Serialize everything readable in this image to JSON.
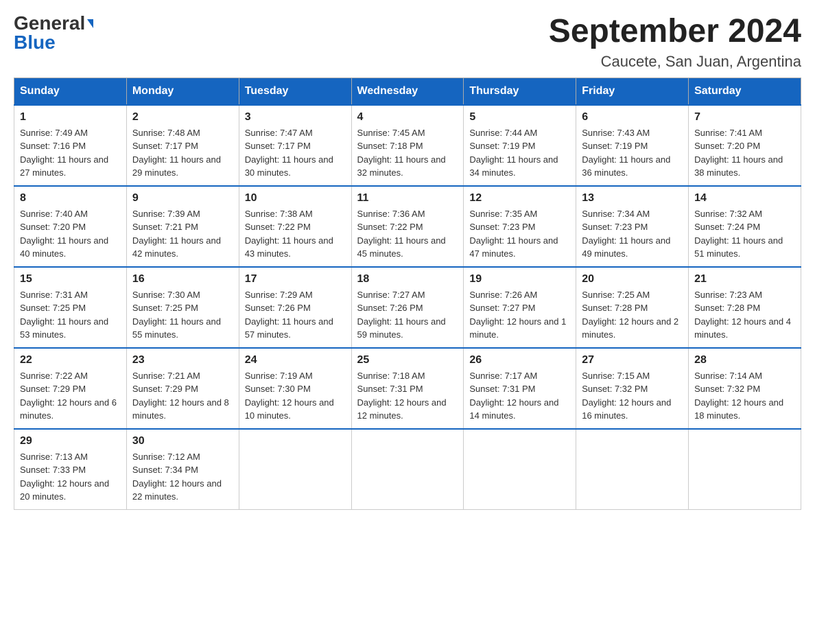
{
  "header": {
    "logo_general": "General",
    "logo_blue": "Blue",
    "month_title": "September 2024",
    "location": "Caucete, San Juan, Argentina"
  },
  "weekdays": [
    "Sunday",
    "Monday",
    "Tuesday",
    "Wednesday",
    "Thursday",
    "Friday",
    "Saturday"
  ],
  "weeks": [
    [
      {
        "day": "1",
        "sunrise": "7:49 AM",
        "sunset": "7:16 PM",
        "daylight": "11 hours and 27 minutes."
      },
      {
        "day": "2",
        "sunrise": "7:48 AM",
        "sunset": "7:17 PM",
        "daylight": "11 hours and 29 minutes."
      },
      {
        "day": "3",
        "sunrise": "7:47 AM",
        "sunset": "7:17 PM",
        "daylight": "11 hours and 30 minutes."
      },
      {
        "day": "4",
        "sunrise": "7:45 AM",
        "sunset": "7:18 PM",
        "daylight": "11 hours and 32 minutes."
      },
      {
        "day": "5",
        "sunrise": "7:44 AM",
        "sunset": "7:19 PM",
        "daylight": "11 hours and 34 minutes."
      },
      {
        "day": "6",
        "sunrise": "7:43 AM",
        "sunset": "7:19 PM",
        "daylight": "11 hours and 36 minutes."
      },
      {
        "day": "7",
        "sunrise": "7:41 AM",
        "sunset": "7:20 PM",
        "daylight": "11 hours and 38 minutes."
      }
    ],
    [
      {
        "day": "8",
        "sunrise": "7:40 AM",
        "sunset": "7:20 PM",
        "daylight": "11 hours and 40 minutes."
      },
      {
        "day": "9",
        "sunrise": "7:39 AM",
        "sunset": "7:21 PM",
        "daylight": "11 hours and 42 minutes."
      },
      {
        "day": "10",
        "sunrise": "7:38 AM",
        "sunset": "7:22 PM",
        "daylight": "11 hours and 43 minutes."
      },
      {
        "day": "11",
        "sunrise": "7:36 AM",
        "sunset": "7:22 PM",
        "daylight": "11 hours and 45 minutes."
      },
      {
        "day": "12",
        "sunrise": "7:35 AM",
        "sunset": "7:23 PM",
        "daylight": "11 hours and 47 minutes."
      },
      {
        "day": "13",
        "sunrise": "7:34 AM",
        "sunset": "7:23 PM",
        "daylight": "11 hours and 49 minutes."
      },
      {
        "day": "14",
        "sunrise": "7:32 AM",
        "sunset": "7:24 PM",
        "daylight": "11 hours and 51 minutes."
      }
    ],
    [
      {
        "day": "15",
        "sunrise": "7:31 AM",
        "sunset": "7:25 PM",
        "daylight": "11 hours and 53 minutes."
      },
      {
        "day": "16",
        "sunrise": "7:30 AM",
        "sunset": "7:25 PM",
        "daylight": "11 hours and 55 minutes."
      },
      {
        "day": "17",
        "sunrise": "7:29 AM",
        "sunset": "7:26 PM",
        "daylight": "11 hours and 57 minutes."
      },
      {
        "day": "18",
        "sunrise": "7:27 AM",
        "sunset": "7:26 PM",
        "daylight": "11 hours and 59 minutes."
      },
      {
        "day": "19",
        "sunrise": "7:26 AM",
        "sunset": "7:27 PM",
        "daylight": "12 hours and 1 minute."
      },
      {
        "day": "20",
        "sunrise": "7:25 AM",
        "sunset": "7:28 PM",
        "daylight": "12 hours and 2 minutes."
      },
      {
        "day": "21",
        "sunrise": "7:23 AM",
        "sunset": "7:28 PM",
        "daylight": "12 hours and 4 minutes."
      }
    ],
    [
      {
        "day": "22",
        "sunrise": "7:22 AM",
        "sunset": "7:29 PM",
        "daylight": "12 hours and 6 minutes."
      },
      {
        "day": "23",
        "sunrise": "7:21 AM",
        "sunset": "7:29 PM",
        "daylight": "12 hours and 8 minutes."
      },
      {
        "day": "24",
        "sunrise": "7:19 AM",
        "sunset": "7:30 PM",
        "daylight": "12 hours and 10 minutes."
      },
      {
        "day": "25",
        "sunrise": "7:18 AM",
        "sunset": "7:31 PM",
        "daylight": "12 hours and 12 minutes."
      },
      {
        "day": "26",
        "sunrise": "7:17 AM",
        "sunset": "7:31 PM",
        "daylight": "12 hours and 14 minutes."
      },
      {
        "day": "27",
        "sunrise": "7:15 AM",
        "sunset": "7:32 PM",
        "daylight": "12 hours and 16 minutes."
      },
      {
        "day": "28",
        "sunrise": "7:14 AM",
        "sunset": "7:32 PM",
        "daylight": "12 hours and 18 minutes."
      }
    ],
    [
      {
        "day": "29",
        "sunrise": "7:13 AM",
        "sunset": "7:33 PM",
        "daylight": "12 hours and 20 minutes."
      },
      {
        "day": "30",
        "sunrise": "7:12 AM",
        "sunset": "7:34 PM",
        "daylight": "12 hours and 22 minutes."
      },
      null,
      null,
      null,
      null,
      null
    ]
  ]
}
